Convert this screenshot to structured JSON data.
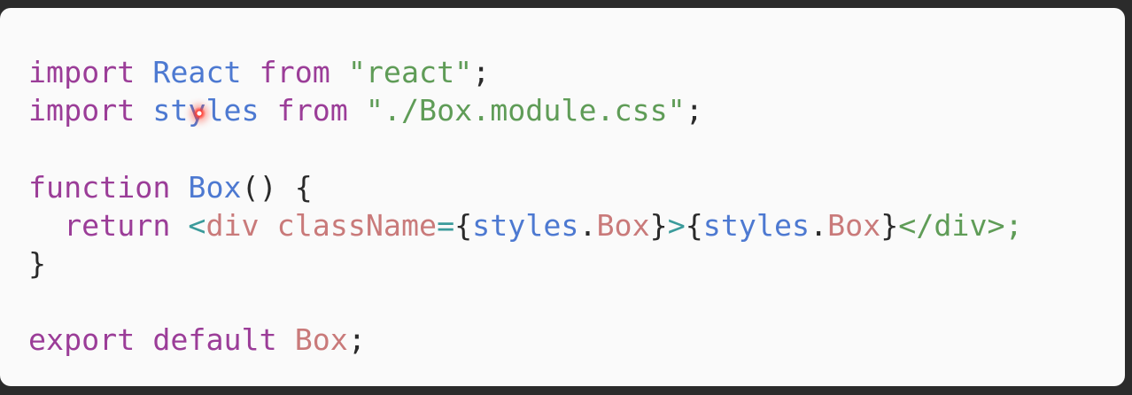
{
  "colors": {
    "keyword": "#9b3d98",
    "identifier": "#4d79d1",
    "string": "#5f9c57",
    "plain": "#2a2a2a",
    "component": "#c97a7a",
    "tag": "#3b9b9b",
    "background": "#fafafa",
    "frame": "#2b2b2b",
    "cursor": "#ff3b2f"
  },
  "code": {
    "lines": [
      [
        {
          "text": "import",
          "kind": "keyword"
        },
        {
          "text": " ",
          "kind": "plain"
        },
        {
          "text": "React",
          "kind": "identifier"
        },
        {
          "text": " ",
          "kind": "plain"
        },
        {
          "text": "from",
          "kind": "keyword"
        },
        {
          "text": " ",
          "kind": "plain"
        },
        {
          "text": "\"react\"",
          "kind": "string"
        },
        {
          "text": ";",
          "kind": "plain"
        }
      ],
      [
        {
          "text": "import",
          "kind": "keyword"
        },
        {
          "text": " ",
          "kind": "plain"
        },
        {
          "text": "styles",
          "kind": "identifier"
        },
        {
          "text": " ",
          "kind": "plain"
        },
        {
          "text": "from",
          "kind": "keyword"
        },
        {
          "text": " ",
          "kind": "plain"
        },
        {
          "text": "\"./Box.module.css\"",
          "kind": "string"
        },
        {
          "text": ";",
          "kind": "plain"
        }
      ],
      [],
      [
        {
          "text": "function",
          "kind": "keyword"
        },
        {
          "text": " ",
          "kind": "plain"
        },
        {
          "text": "Box",
          "kind": "identifier"
        },
        {
          "text": "() {",
          "kind": "plain"
        }
      ],
      [
        {
          "text": "  ",
          "kind": "plain"
        },
        {
          "text": "return",
          "kind": "keyword"
        },
        {
          "text": " ",
          "kind": "plain"
        },
        {
          "text": "<",
          "kind": "tag"
        },
        {
          "text": "div",
          "kind": "component"
        },
        {
          "text": " ",
          "kind": "plain"
        },
        {
          "text": "className",
          "kind": "component"
        },
        {
          "text": "=",
          "kind": "tag"
        },
        {
          "text": "{",
          "kind": "plain"
        },
        {
          "text": "styles",
          "kind": "identifier"
        },
        {
          "text": ".",
          "kind": "plain"
        },
        {
          "text": "Box",
          "kind": "component"
        },
        {
          "text": "}",
          "kind": "plain"
        },
        {
          "text": ">",
          "kind": "tag"
        },
        {
          "text": "{",
          "kind": "plain"
        },
        {
          "text": "styles",
          "kind": "identifier"
        },
        {
          "text": ".",
          "kind": "plain"
        },
        {
          "text": "Box",
          "kind": "component"
        },
        {
          "text": "}",
          "kind": "plain"
        },
        {
          "text": "</div>;",
          "kind": "string"
        }
      ],
      [
        {
          "text": "}",
          "kind": "plain"
        }
      ],
      [],
      [
        {
          "text": "export",
          "kind": "keyword"
        },
        {
          "text": " ",
          "kind": "plain"
        },
        {
          "text": "default",
          "kind": "keyword"
        },
        {
          "text": " ",
          "kind": "plain"
        },
        {
          "text": "Box",
          "kind": "component"
        },
        {
          "text": ";",
          "kind": "plain"
        }
      ]
    ]
  }
}
